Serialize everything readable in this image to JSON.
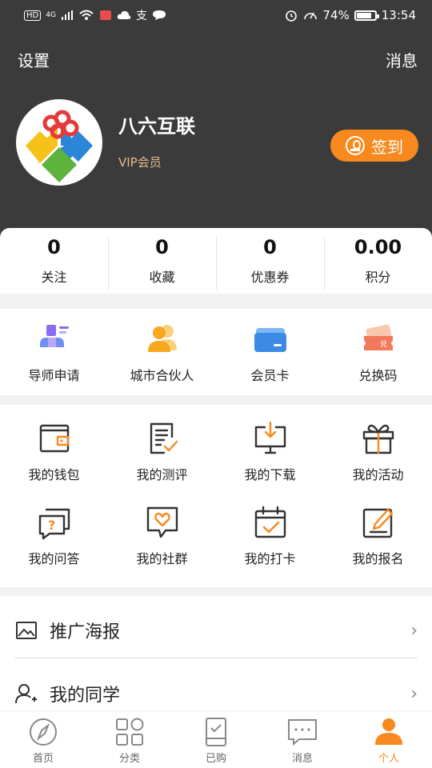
{
  "status_bar": {
    "left_badge": "HD",
    "network": "4G",
    "battery_percent": "74%",
    "battery_level": 0.74,
    "time": "13:54"
  },
  "header": {
    "settings": "设置",
    "messages": "消息",
    "username": "八六互联",
    "member_level": "VIP会员",
    "checkin_label": "签到"
  },
  "stats": [
    {
      "value": "0",
      "label": "关注"
    },
    {
      "value": "0",
      "label": "收藏"
    },
    {
      "value": "0",
      "label": "优惠券"
    },
    {
      "value": "0.00",
      "label": "积分"
    }
  ],
  "features": [
    {
      "label": "导师申请",
      "icon": "mentor-icon"
    },
    {
      "label": "城市合伙人",
      "icon": "partner-icon"
    },
    {
      "label": "会员卡",
      "icon": "member-card-icon"
    },
    {
      "label": "兑换码",
      "icon": "redeem-code-icon"
    }
  ],
  "my_services": [
    {
      "label": "我的钱包",
      "icon": "wallet-icon"
    },
    {
      "label": "我的测评",
      "icon": "assessment-icon"
    },
    {
      "label": "我的下载",
      "icon": "download-icon"
    },
    {
      "label": "我的活动",
      "icon": "gift-icon"
    },
    {
      "label": "我的问答",
      "icon": "qa-icon"
    },
    {
      "label": "我的社群",
      "icon": "community-icon"
    },
    {
      "label": "我的打卡",
      "icon": "calendar-check-icon"
    },
    {
      "label": "我的报名",
      "icon": "signup-edit-icon"
    }
  ],
  "list": [
    {
      "label": "推广海报",
      "icon": "poster-image-icon"
    },
    {
      "label": "我的同学",
      "icon": "add-user-icon"
    }
  ],
  "tabs": [
    {
      "label": "首页",
      "icon": "compass-icon"
    },
    {
      "label": "分类",
      "icon": "category-grid-icon"
    },
    {
      "label": "已购",
      "icon": "purchased-icon"
    },
    {
      "label": "消息",
      "icon": "chat-icon"
    },
    {
      "label": "个人",
      "icon": "person-icon",
      "active": true
    }
  ],
  "colors": {
    "accent": "#f7891e",
    "header_bg": "#3b3b3b",
    "vip_text": "#e6b98a"
  }
}
